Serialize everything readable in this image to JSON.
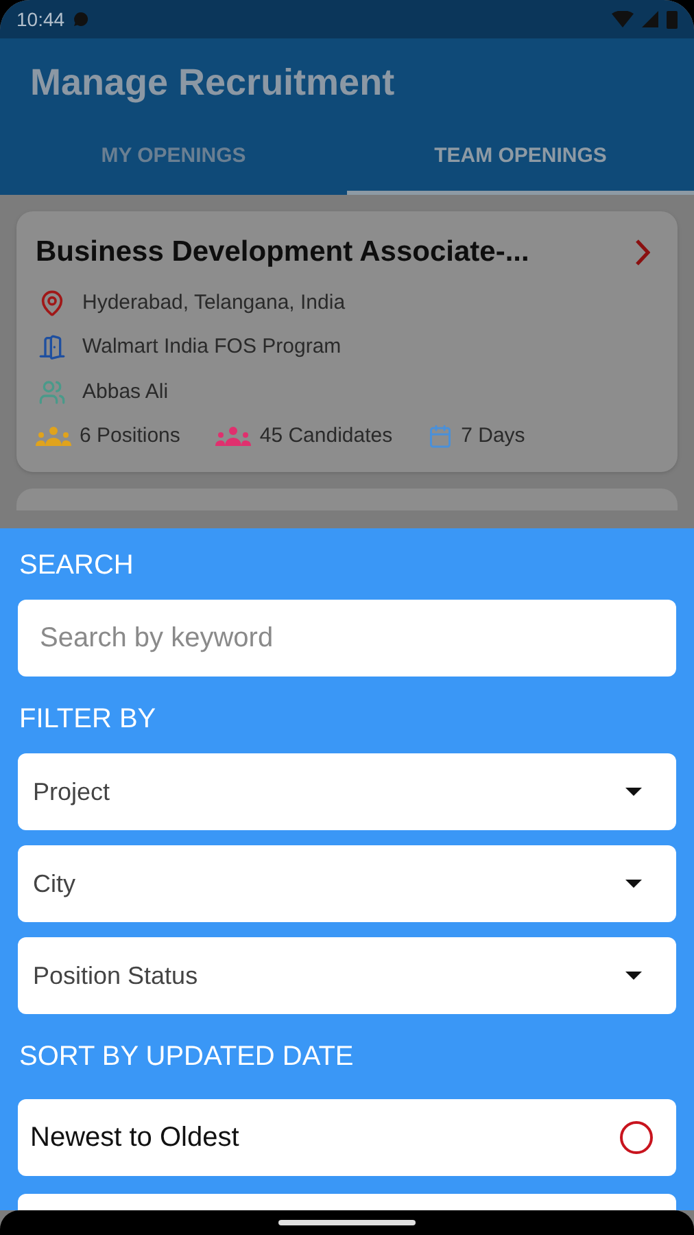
{
  "status_bar": {
    "time": "10:44"
  },
  "app_bar": {
    "title": "Manage Recruitment"
  },
  "tabs": [
    {
      "label": "MY OPENINGS",
      "selected": false
    },
    {
      "label": "TEAM OPENINGS",
      "selected": true
    }
  ],
  "openings": [
    {
      "title": "Business Development Associate-...",
      "details": [
        {
          "kind": "location",
          "text": "Hyderabad, Telangana, India"
        },
        {
          "kind": "project",
          "text": "Walmart India FOS Program"
        },
        {
          "kind": "owner",
          "text": "Abbas Ali"
        }
      ],
      "stats": [
        {
          "kind": "group",
          "text": "6 Positions",
          "color": "#e0a31c"
        },
        {
          "kind": "group",
          "text": "45 Candidates",
          "color": "#e0306e"
        },
        {
          "kind": "calendar",
          "text": "7 Days",
          "color": "#4a90d9"
        }
      ]
    }
  ],
  "filter_sheet": {
    "search_label": "SEARCH",
    "search": {
      "placeholder": "Search by keyword"
    },
    "filter_label": "FILTER BY",
    "filters": [
      {
        "placeholder": "Project"
      },
      {
        "placeholder": "City"
      },
      {
        "placeholder": "Position Status"
      }
    ],
    "sort_label": "SORT BY UPDATED DATE",
    "sort_options": [
      {
        "label": "Newest to Oldest",
        "selected": false
      }
    ]
  }
}
